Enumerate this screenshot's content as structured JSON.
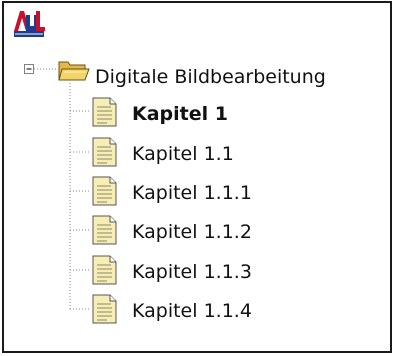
{
  "logo": {
    "icon": "logo-icon"
  },
  "tree": {
    "root": {
      "label": "Digitale Bildbearbeitung",
      "expander_icon": "minus-box-icon",
      "icon": "folder-open-icon",
      "expanded": true
    },
    "items": [
      {
        "label": "Kapitel 1",
        "bold": true,
        "icon": "document-icon"
      },
      {
        "label": "Kapitel 1.1",
        "bold": false,
        "icon": "document-icon"
      },
      {
        "label": "Kapitel 1.1.1",
        "bold": false,
        "icon": "document-icon"
      },
      {
        "label": "Kapitel 1.1.2",
        "bold": false,
        "icon": "document-icon"
      },
      {
        "label": "Kapitel 1.1.3",
        "bold": false,
        "icon": "document-icon"
      },
      {
        "label": "Kapitel 1.1.4",
        "bold": false,
        "icon": "document-icon"
      }
    ]
  },
  "colors": {
    "logo_red": "#c8102e",
    "logo_blue": "#1b3d8f",
    "folder_yellow": "#f2d46a",
    "document_cream": "#f6eeb4",
    "tree_line": "#8a8a8a"
  }
}
